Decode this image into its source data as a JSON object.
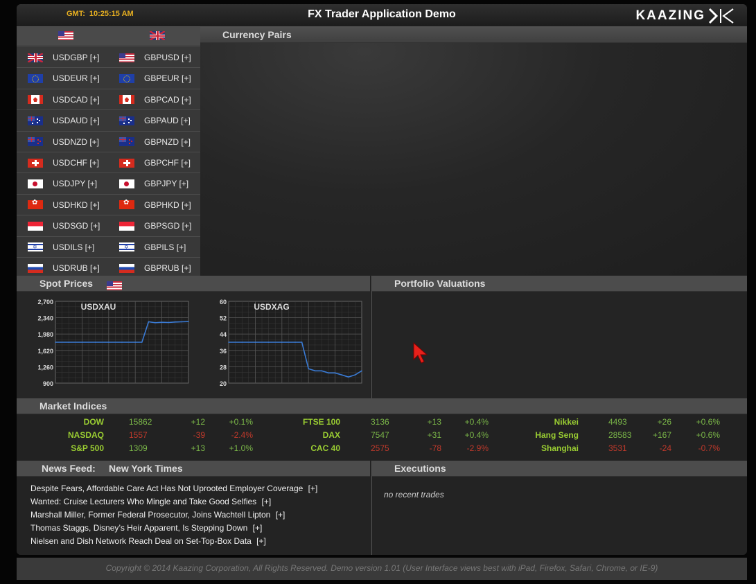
{
  "header": {
    "gmt_label": "GMT:",
    "time": "10:25:15 AM",
    "title": "FX Trader Application Demo",
    "brand": "KAAZING"
  },
  "currency_pairs": {
    "title": "Currency Pairs",
    "column_flags": [
      "us-flag-icon",
      "uk-flag-icon"
    ],
    "rows": [
      {
        "flag": "uk-flag-icon",
        "usd": "USDGBP [+]",
        "gbp_flag": "us-flag-icon",
        "gbp": "GBPUSD [+]"
      },
      {
        "flag": "eu-flag-icon",
        "usd": "USDEUR [+]",
        "gbp_flag": "eu-flag-icon",
        "gbp": "GBPEUR [+]"
      },
      {
        "flag": "ca-flag-icon",
        "usd": "USDCAD [+]",
        "gbp_flag": "ca-flag-icon",
        "gbp": "GBPCAD [+]"
      },
      {
        "flag": "au-flag-icon",
        "usd": "USDAUD [+]",
        "gbp_flag": "au-flag-icon",
        "gbp": "GBPAUD [+]"
      },
      {
        "flag": "nz-flag-icon",
        "usd": "USDNZD [+]",
        "gbp_flag": "nz-flag-icon",
        "gbp": "GBPNZD [+]"
      },
      {
        "flag": "ch-flag-icon",
        "usd": "USDCHF [+]",
        "gbp_flag": "ch-flag-icon",
        "gbp": "GBPCHF [+]"
      },
      {
        "flag": "jp-flag-icon",
        "usd": "USDJPY [+]",
        "gbp_flag": "jp-flag-icon",
        "gbp": "GBPJPY [+]"
      },
      {
        "flag": "hk-flag-icon",
        "usd": "USDHKD [+]",
        "gbp_flag": "hk-flag-icon",
        "gbp": "GBPHKD [+]"
      },
      {
        "flag": "sg-flag-icon",
        "usd": "USDSGD [+]",
        "gbp_flag": "sg-flag-icon",
        "gbp": "GBPSGD [+]"
      },
      {
        "flag": "il-flag-icon",
        "usd": "USDILS [+]",
        "gbp_flag": "il-flag-icon",
        "gbp": "GBPILS [+]"
      },
      {
        "flag": "ru-flag-icon",
        "usd": "USDRUB [+]",
        "gbp_flag": "ru-flag-icon",
        "gbp": "GBPRUB [+]"
      }
    ]
  },
  "spot_prices": {
    "title": "Spot Prices",
    "flag": "us-flag-icon"
  },
  "portfolio": {
    "title": "Portfolio Valuations"
  },
  "chart_data": [
    {
      "type": "line",
      "title": "USDXAU",
      "yticks": [
        "2,700",
        "2,340",
        "1,980",
        "1,620",
        "1,260",
        "900"
      ],
      "ylim": [
        900,
        2700
      ],
      "x": [
        0,
        10,
        20,
        30,
        40,
        50,
        60,
        65,
        70,
        75,
        80,
        85,
        90,
        95,
        100
      ],
      "values": [
        1800,
        1800,
        1800,
        1800,
        1800,
        1800,
        1800,
        1800,
        2250,
        2230,
        2240,
        2235,
        2245,
        2250,
        2255
      ]
    },
    {
      "type": "line",
      "title": "USDXAG",
      "yticks": [
        "60",
        "52",
        "44",
        "36",
        "28",
        "20"
      ],
      "ylim": [
        20,
        60
      ],
      "x": [
        0,
        10,
        20,
        30,
        40,
        50,
        55,
        60,
        65,
        70,
        75,
        80,
        85,
        90,
        95,
        100
      ],
      "values": [
        40,
        40,
        40,
        40,
        40,
        40,
        40,
        27,
        26,
        26,
        25,
        25,
        24,
        23,
        24,
        26
      ]
    }
  ],
  "market_indices": {
    "title": "Market Indices",
    "rows": [
      [
        {
          "name": "DOW",
          "value": "15862",
          "change": "+12",
          "pct": "+0.1%",
          "dir": "up"
        },
        {
          "name": "FTSE 100",
          "value": "3136",
          "change": "+13",
          "pct": "+0.4%",
          "dir": "up"
        },
        {
          "name": "Nikkei",
          "value": "4493",
          "change": "+26",
          "pct": "+0.6%",
          "dir": "up"
        }
      ],
      [
        {
          "name": "NASDAQ",
          "value": "1557",
          "change": "-39",
          "pct": "-2.4%",
          "dir": "down"
        },
        {
          "name": "DAX",
          "value": "7547",
          "change": "+31",
          "pct": "+0.4%",
          "dir": "up"
        },
        {
          "name": "Hang Seng",
          "value": "28583",
          "change": "+167",
          "pct": "+0.6%",
          "dir": "up"
        }
      ],
      [
        {
          "name": "S&P 500",
          "value": "1309",
          "change": "+13",
          "pct": "+1.0%",
          "dir": "up"
        },
        {
          "name": "CAC 40",
          "value": "2575",
          "change": "-78",
          "pct": "-2.9%",
          "dir": "down"
        },
        {
          "name": "Shanghai",
          "value": "3531",
          "change": "-24",
          "pct": "-0.7%",
          "dir": "down"
        }
      ]
    ]
  },
  "news": {
    "title": "News Feed:",
    "source": "New York Times",
    "items": [
      "Despite Fears, Affordable Care Act Has Not Uprooted Employer Coverage",
      "Wanted: Cruise Lecturers Who Mingle and Take Good Selfies",
      "Marshall Miller, Former Federal Prosecutor, Joins Wachtell Lipton",
      "Thomas Staggs, Disney’s Heir Apparent, Is Stepping Down",
      "Nielsen and Dish Network Reach Deal on Set-Top-Box Data"
    ],
    "expand_label": "[+]"
  },
  "executions": {
    "title": "Executions",
    "empty": "no recent trades"
  },
  "footer": "Copyright © 2014 Kaazing Corporation,   All Rights Reserved. Demo version 1.01 (User Interface views best with iPad, Firefox, Safari, Chrome, or IE-9)",
  "colors": {
    "up": "#7ab648",
    "down": "#c0392b",
    "accent": "#e8b020",
    "line": "#3a7bd5"
  }
}
